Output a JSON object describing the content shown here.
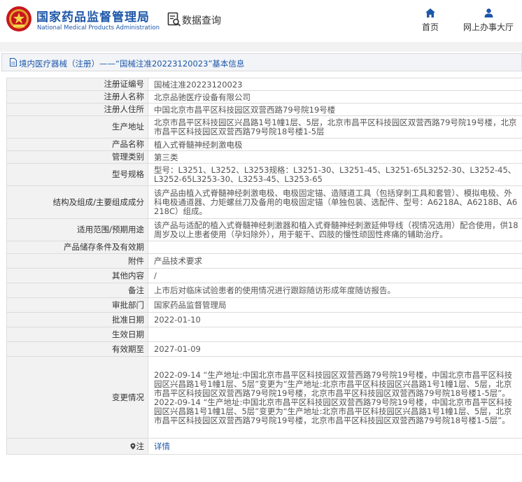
{
  "header": {
    "org_name_cn": "国家药品监督管理局",
    "org_name_en": "National Medical Products Administration",
    "data_query": "数据查询",
    "nav_home": "首页",
    "nav_office": "网上办事大厅"
  },
  "title_bar": {
    "breadcrumb": "境内医疗器械（注册）——“国械注准20223120023”基本信息"
  },
  "details": [
    {
      "label": "注册证编号",
      "value": "国械注准20223120023"
    },
    {
      "label": "注册人名称",
      "value": "北京品驰医疗设备有限公司"
    },
    {
      "label": "注册人住所",
      "value": "中国北京市昌平区科技园区双营西路79号院19号楼"
    },
    {
      "label": "生产地址",
      "value": "北京市昌平区科技园区兴昌路1号1幢1层、5层，北京市昌平区科技园区双营西路79号院19号楼，北京市昌平区科技园区双营西路79号院18号楼1-5层"
    },
    {
      "label": "产品名称",
      "value": "植入式脊髓神经刺激电极"
    },
    {
      "label": "管理类别",
      "value": "第三类"
    },
    {
      "label": "型号规格",
      "value": "型号：L3251、L3252、L3253规格：L3251-30、L3251-45、L3251-65L3252-30、L3252-45、L3252-65L3253-30、L3253-45、L3253-65"
    },
    {
      "label": "结构及组成/主要组成成分",
      "value": "该产品由植入式脊髓神经刺激电极、电极固定锚、造隧道工具（包括穿刺工具和套管）、模拟电极、外科电极通道器、力矩螺丝刀及备用的电极固定锚（单独包装、选配件、型号：A6218A、A6218B、A6218C）组成。"
    },
    {
      "label": "适用范围/预期用途",
      "value": "该产品与适配的植入式脊髓神经刺激器和植入式脊髓神经刺激延伸导线（视情况选用）配合使用，供18周岁及以上患者使用（孕妇除外），用于躯干、四肢的慢性顽固性疼痛的辅助治疗。"
    },
    {
      "label": "产品储存条件及有效期",
      "value": ""
    },
    {
      "label": "附件",
      "value": "产品技术要求"
    },
    {
      "label": "其他内容",
      "value": "/"
    },
    {
      "label": "备注",
      "value": "上市后对临床试验患者的使用情况进行跟踪随访形成年度随访报告。"
    },
    {
      "label": "审批部门",
      "value": "国家药品监督管理局"
    },
    {
      "label": "批准日期",
      "value": "2022-01-10"
    },
    {
      "label": "生效日期",
      "value": ""
    },
    {
      "label": "有效期至",
      "value": "2027-01-09"
    }
  ],
  "change_log": {
    "label": "变更情况",
    "entries": [
      "2022-09-14 “生产地址:中国北京市昌平区科技园区双营西路79号院19号楼，中国北京市昌平区科技园区兴昌路1号1幢1层、5层”变更为“生产地址:北京市昌平区科技园区兴昌路1号1幢1层、5层，北京市昌平区科技园区双营西路79号院19号楼，北京市昌平区科技园区双营西路79号院18号楼1-5层”。",
      "2022-09-14 “生产地址:中国北京市昌平区科技园区双营西路79号院19号楼，中国北京市昌平区科技园区兴昌路1号1幢1层、5层”变更为“生产地址:北京市昌平区科技园区兴昌路1号1幢1层、5层，北京市昌平区科技园区双营西路79号院19号楼，北京市昌平区科技园区双营西路79号院18号楼1-5层”。"
    ]
  },
  "note": {
    "label": "注",
    "link": "详情"
  }
}
